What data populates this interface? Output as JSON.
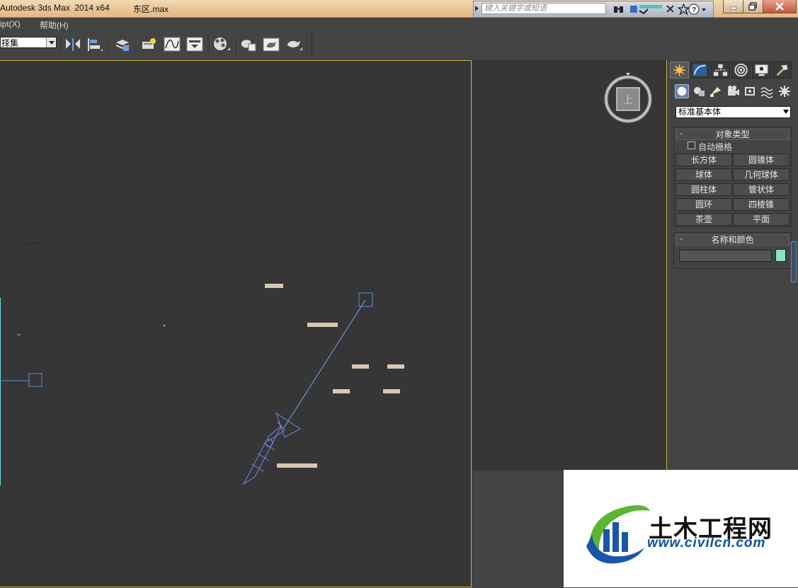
{
  "titlebar": {
    "app_title": "Autodesk 3ds Max  2014 x64",
    "file_name": "东区.max",
    "search_placeholder": "键入关键字或短语"
  },
  "menubar": {
    "items": [
      "ipt(X)",
      "帮助(H)"
    ]
  },
  "toolbar": {
    "selection_set": "择集"
  },
  "command_panel": {
    "dropdown_value": "标准基本体",
    "object_type": {
      "title": "对象类型",
      "minus": "-",
      "auto_grid": "自动栅格",
      "buttons": [
        "长方体",
        "圆锥体",
        "球体",
        "几何球体",
        "圆柱体",
        "管状体",
        "圆环",
        "四棱锥",
        "茶壶",
        "平面"
      ]
    },
    "name_color": {
      "title": "名称和颜色",
      "minus": "-",
      "name_value": "",
      "color": "#8ee0c4"
    }
  },
  "viewcube": {
    "face_label": "上"
  },
  "watermark": {
    "title": "土木工程网",
    "url": "www.civilcn.com"
  },
  "colors": {
    "active_viewport_border": "#c9b23a",
    "titlebar": "#e9c495",
    "viewport_bg": "#363636"
  }
}
